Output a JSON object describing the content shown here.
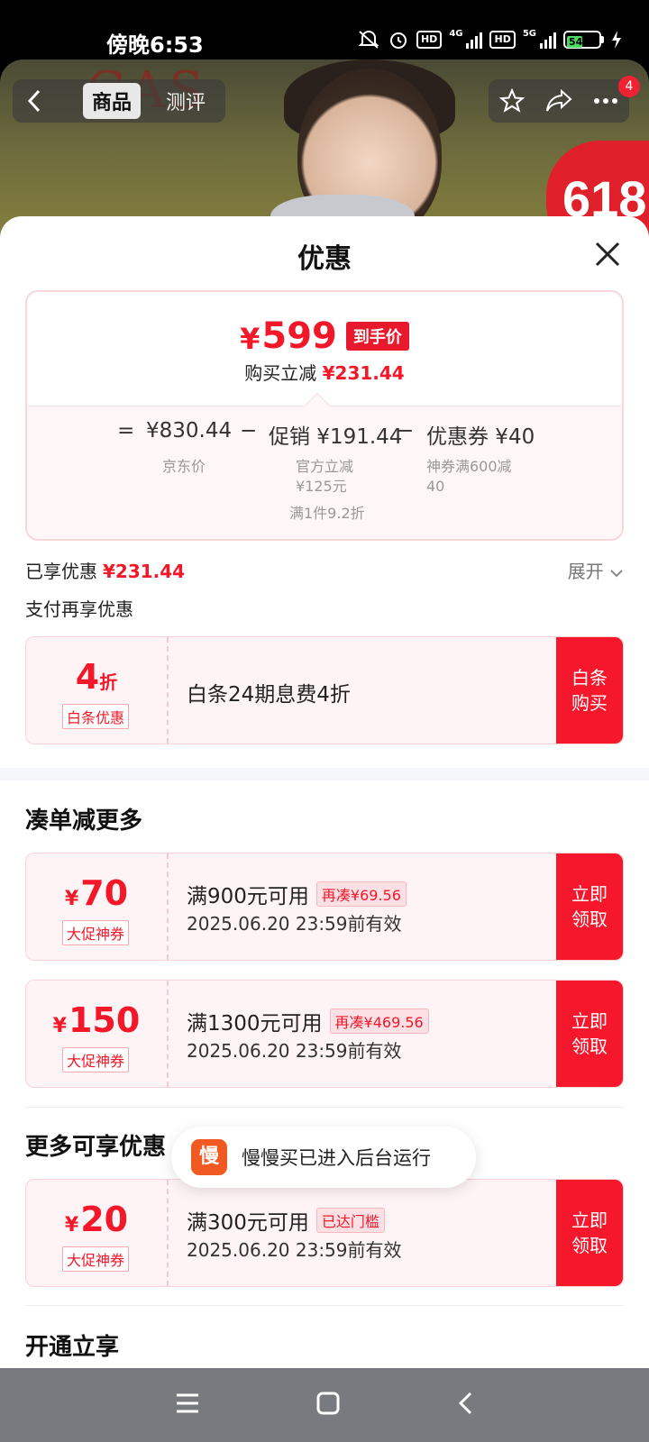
{
  "status_bar": {
    "time": "傍晚6:53",
    "net1": "4G",
    "net2": "5G",
    "hd": "HD",
    "battery": "54"
  },
  "product_nav": {
    "tabs": [
      "商品",
      "测评"
    ],
    "notification_count": "4",
    "brand_text": "CAS",
    "promo_badge": "618"
  },
  "sheet": {
    "title": "优惠",
    "price": {
      "yen": "¥",
      "value": "599",
      "tag": "到手价",
      "reduce_label": "购买立减",
      "reduce_value": "¥231.44"
    },
    "formula": {
      "eq": "=",
      "jd_price": "¥830.44",
      "minus1": "−",
      "promo": "促销 ¥191.44",
      "minus2": "−",
      "coupon": "优惠券 ¥40",
      "jd_label": "京东价",
      "promo_sub1": "官方立减",
      "promo_sub2": "¥125元",
      "promo_sub3": "满1件9.2折",
      "coupon_sub1": "神券满600减",
      "coupon_sub2": "40"
    },
    "enjoyed_label": "已享优惠",
    "enjoyed_value": "¥231.44",
    "expand_label": "展开",
    "pay_more": "支付再享优惠",
    "baitiao": {
      "amount": "4",
      "unit": "折",
      "tag": "白条优惠",
      "desc": "白条24期息费4折",
      "btn_l1": "白条",
      "btn_l2": "购买"
    },
    "more_section_title": "凑单减更多",
    "coupons": [
      {
        "yen": "¥",
        "amount": "70",
        "tag": "大促神券",
        "cond": "满900元可用",
        "pill": "再凑¥69.56",
        "valid": "2025.06.20 23:59前有效",
        "btn_l1": "立即",
        "btn_l2": "领取"
      },
      {
        "yen": "¥",
        "amount": "150",
        "tag": "大促神券",
        "cond": "满1300元可用",
        "pill": "再凑¥469.56",
        "valid": "2025.06.20 23:59前有效",
        "btn_l1": "立即",
        "btn_l2": "领取"
      }
    ],
    "extra_section_title": "更多可享优惠",
    "extra_coupon": {
      "yen": "¥",
      "amount": "20",
      "tag": "大促神券",
      "cond": "满300元可用",
      "pill": "已达门槛",
      "valid": "2025.06.20 23:59前有效",
      "btn_l1": "立即",
      "btn_l2": "领取"
    },
    "cutoff_title": "开通立享"
  },
  "toast": {
    "app_icon_text": "慢",
    "text": "慢慢买已进入后台运行"
  }
}
